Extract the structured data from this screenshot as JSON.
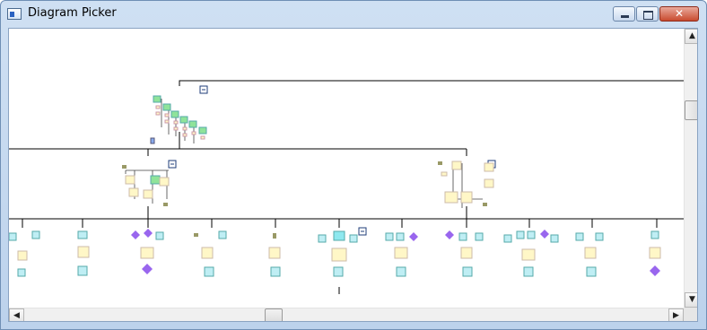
{
  "window": {
    "title": "Diagram Picker",
    "minimize_glyph": "",
    "maximize_glyph": "",
    "close_glyph": "✕"
  },
  "scrollbars": {
    "up_arrow": "▲",
    "down_arrow": "▼",
    "left_arrow": "◀",
    "right_arrow": "▶"
  },
  "colors": {
    "node_yellow": "#fff7c7",
    "node_green": "#8fe39a",
    "node_cyan": "#bfeef4",
    "node_purple": "#9966ee",
    "connector": "#000000",
    "collapse_box": "#1f3d7a"
  }
}
